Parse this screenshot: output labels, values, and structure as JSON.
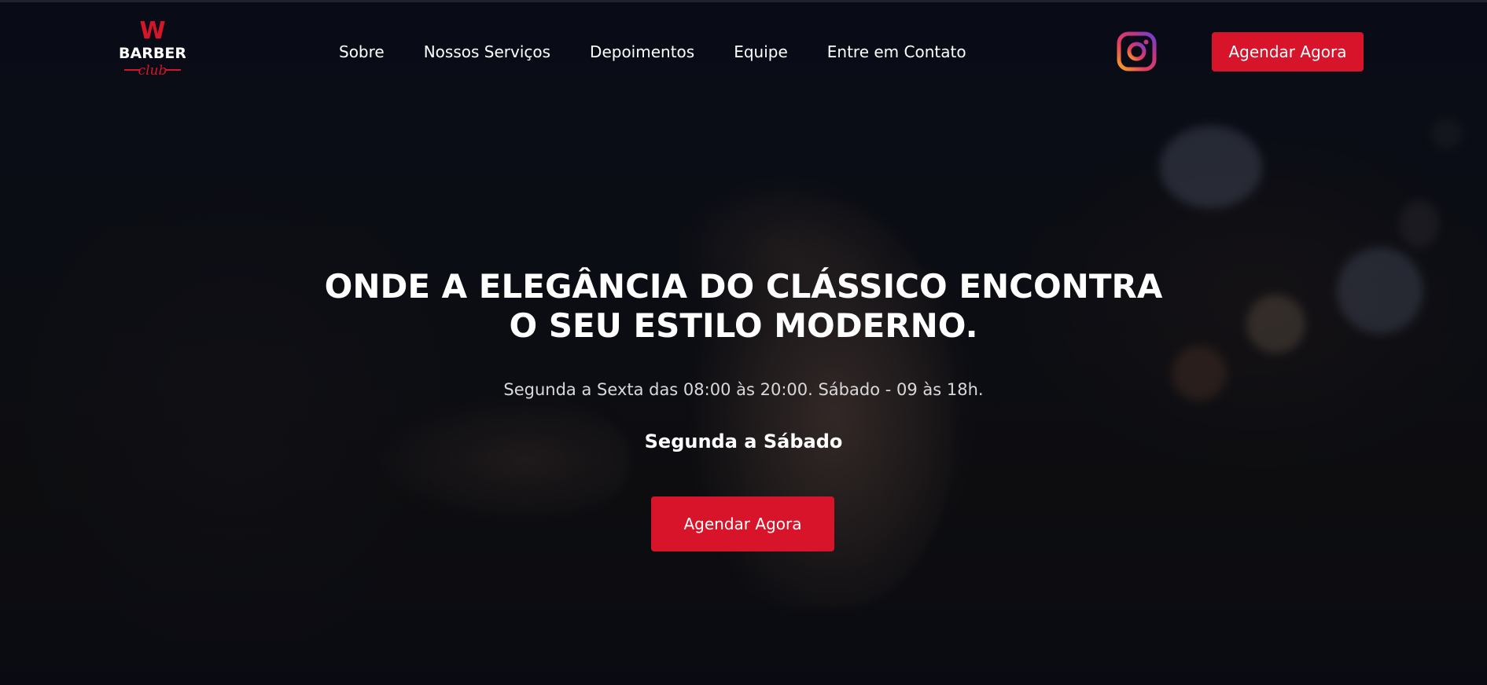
{
  "brand": {
    "logo_word": "BARBER",
    "logo_script": "club",
    "logo_letter": "W",
    "accent_color": "#d7142a"
  },
  "nav": {
    "items": [
      {
        "label": "Sobre"
      },
      {
        "label": "Nossos Serviços"
      },
      {
        "label": "Depoimentos"
      },
      {
        "label": "Equipe"
      },
      {
        "label": "Entre em Contato"
      }
    ]
  },
  "header": {
    "social_icon": "instagram-icon",
    "cta_label": "Agendar Agora"
  },
  "hero": {
    "title_line1": "ONDE A ELEGÂNCIA DO CLÁSSICO ENCONTRA",
    "title_line2": "O SEU ESTILO MODERNO.",
    "hours": "Segunda a Sexta das 08:00 às 20:00. Sábado - 09 às 18h.",
    "days": "Segunda a Sábado",
    "cta_label": "Agendar Agora"
  }
}
